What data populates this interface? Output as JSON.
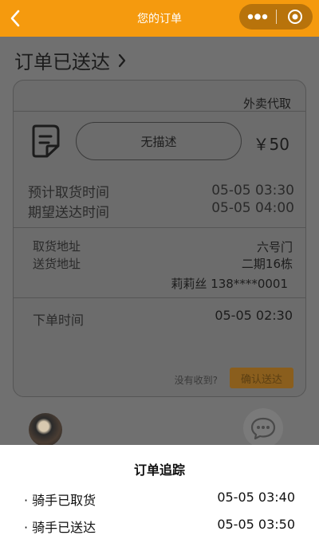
{
  "header": {
    "title": "您的订单",
    "back_icon": "chevron-left-icon",
    "more_icon": "more-dots-icon",
    "close_icon": "target-close-icon",
    "bg_color": "#f59a0e"
  },
  "status": {
    "title": "订单已送达",
    "arrow_icon": "chevron-right-icon"
  },
  "order": {
    "service_type": "外卖代取",
    "icon": "order-document-icon",
    "description": "无描述",
    "price": "￥50",
    "pickup_time_label": "预计取货时间",
    "pickup_time": "05-05 03:30",
    "delivery_time_label": "期望送达时间",
    "delivery_time": "05-05 04:00",
    "pickup_address_label": "取货地址",
    "pickup_address": "六号门",
    "delivery_address_label": "送货地址",
    "delivery_address": "二期16栋",
    "receiver": "莉莉丝 138****0001",
    "order_time_label": "下单时间",
    "order_time": "05-05 02:30",
    "not_received_text": "没有收到?",
    "confirm_label": "确认送达"
  },
  "rider": {
    "avatar_icon": "rider-avatar",
    "chat_icon": "chat-bubble-icon"
  },
  "tracking": {
    "title": "订单追踪",
    "events": [
      {
        "label": "· 骑手已取货",
        "time": "05-05 03:40"
      },
      {
        "label": "· 骑手已送达",
        "time": "05-05 03:50"
      }
    ]
  }
}
